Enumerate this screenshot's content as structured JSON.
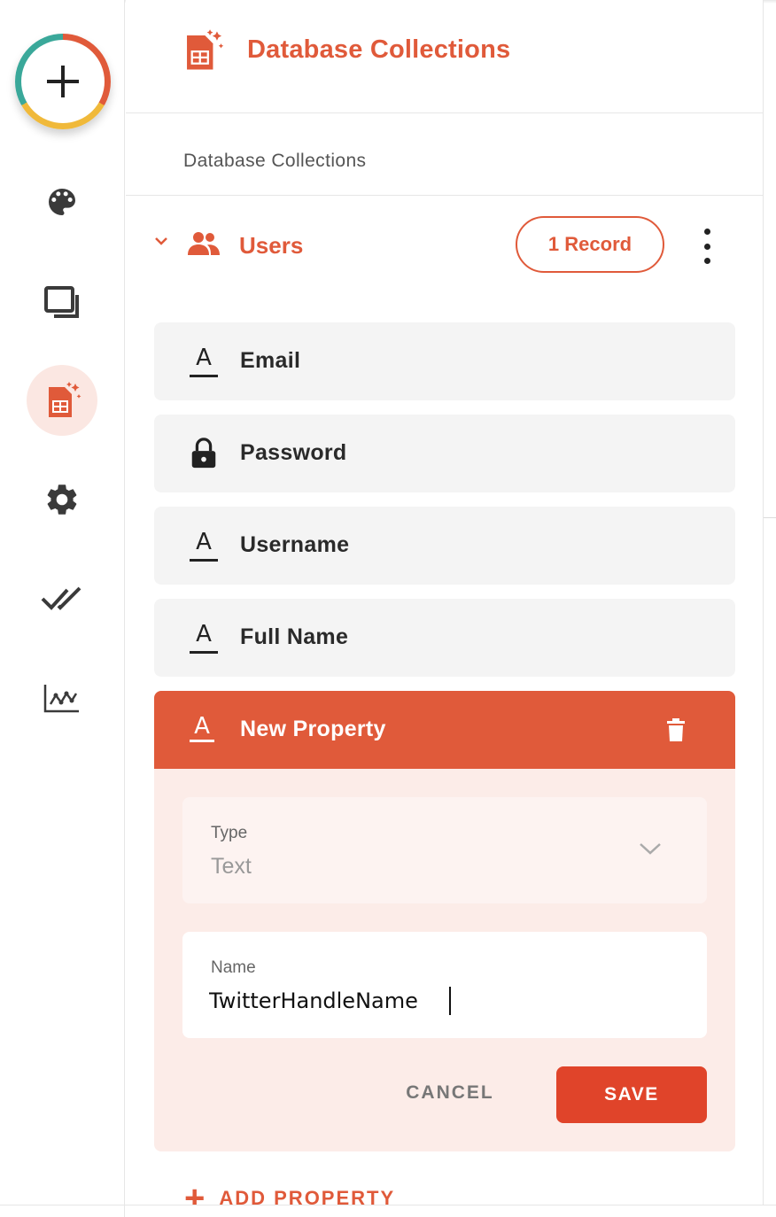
{
  "rail": {
    "items": [
      {
        "name": "palette-icon"
      },
      {
        "name": "pages-icon"
      },
      {
        "name": "database-icon",
        "active": true
      },
      {
        "name": "gear-icon"
      },
      {
        "name": "double-check-icon"
      },
      {
        "name": "analytics-icon"
      }
    ]
  },
  "header": {
    "title": "Database Collections"
  },
  "section": {
    "label": "Database Collections"
  },
  "collection": {
    "name": "Users",
    "record_count": "1 Record",
    "properties": [
      {
        "label": "Email",
        "icon": "text-type-icon"
      },
      {
        "label": "Password",
        "icon": "lock-icon"
      },
      {
        "label": "Username",
        "icon": "text-type-icon"
      },
      {
        "label": "Full Name",
        "icon": "text-type-icon"
      }
    ],
    "new_property": {
      "title": "New Property",
      "type_label": "Type",
      "type_value": "Text",
      "name_label": "Name",
      "name_value": "TwitterHandleName",
      "cancel_label": "CANCEL",
      "save_label": "SAVE"
    },
    "add_property_label": "ADD PROPERTY"
  },
  "colors": {
    "accent": "#e05a3a",
    "save": "#e0442a",
    "card_bg": "#fcece8",
    "row_bg": "#f4f4f4"
  }
}
